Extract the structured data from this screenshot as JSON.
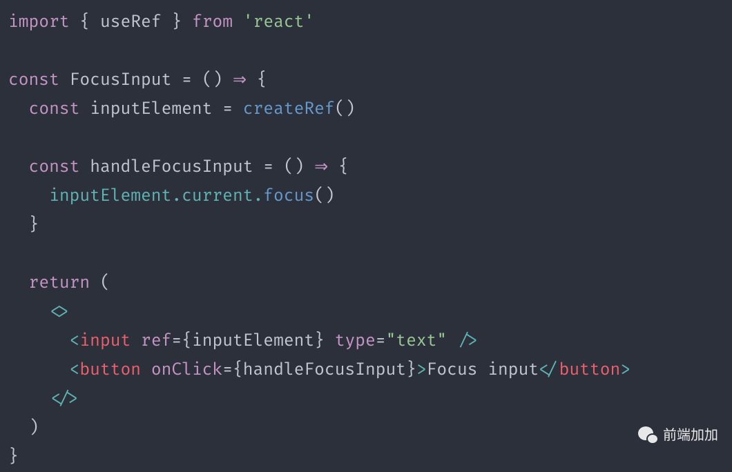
{
  "code": {
    "line1": {
      "import": "import",
      "brace_open": "{",
      "useRef": "useRef",
      "brace_close": "}",
      "from": "from",
      "react": "'react'"
    },
    "line3": {
      "const": "const",
      "FocusInput": "FocusInput",
      "equals": "=",
      "parens": "()",
      "arrow": "⇒",
      "brace": "{"
    },
    "line4": {
      "const": "const",
      "inputElement": "inputElement",
      "equals": "=",
      "createRef": "createRef",
      "parens": "()"
    },
    "line6": {
      "const": "const",
      "handleFocusInput": "handleFocusInput",
      "equals": "=",
      "parens": "()",
      "arrow": "⇒",
      "brace": "{"
    },
    "line7": {
      "inputElement": "inputElement",
      "dot1": ".",
      "current": "current",
      "dot2": ".",
      "focus": "focus",
      "parens": "()"
    },
    "line8": {
      "brace": "}"
    },
    "line10": {
      "return": "return",
      "paren": "("
    },
    "line11": {
      "fragment_open": "<>"
    },
    "line12": {
      "bracket_open": "<",
      "input": "input",
      "ref": "ref",
      "equals": "=",
      "brace_open": "{",
      "inputElement": "inputElement",
      "brace_close": "}",
      "type": "type",
      "equals2": "=",
      "text": "\"text\"",
      "self_close": "/>"
    },
    "line13": {
      "bracket_open": "<",
      "button": "button",
      "onClick": "onClick",
      "equals": "=",
      "brace_open": "{",
      "handleFocusInput": "handleFocusInput",
      "brace_close": "}",
      "gt": ">",
      "text": "Focus input",
      "close_open": "</",
      "button2": "button",
      "gt2": ">"
    },
    "line14": {
      "fragment_close": "</>"
    },
    "line15": {
      "paren": ")"
    },
    "line16": {
      "brace": "}"
    }
  },
  "watermark": {
    "text": "前端加加"
  }
}
